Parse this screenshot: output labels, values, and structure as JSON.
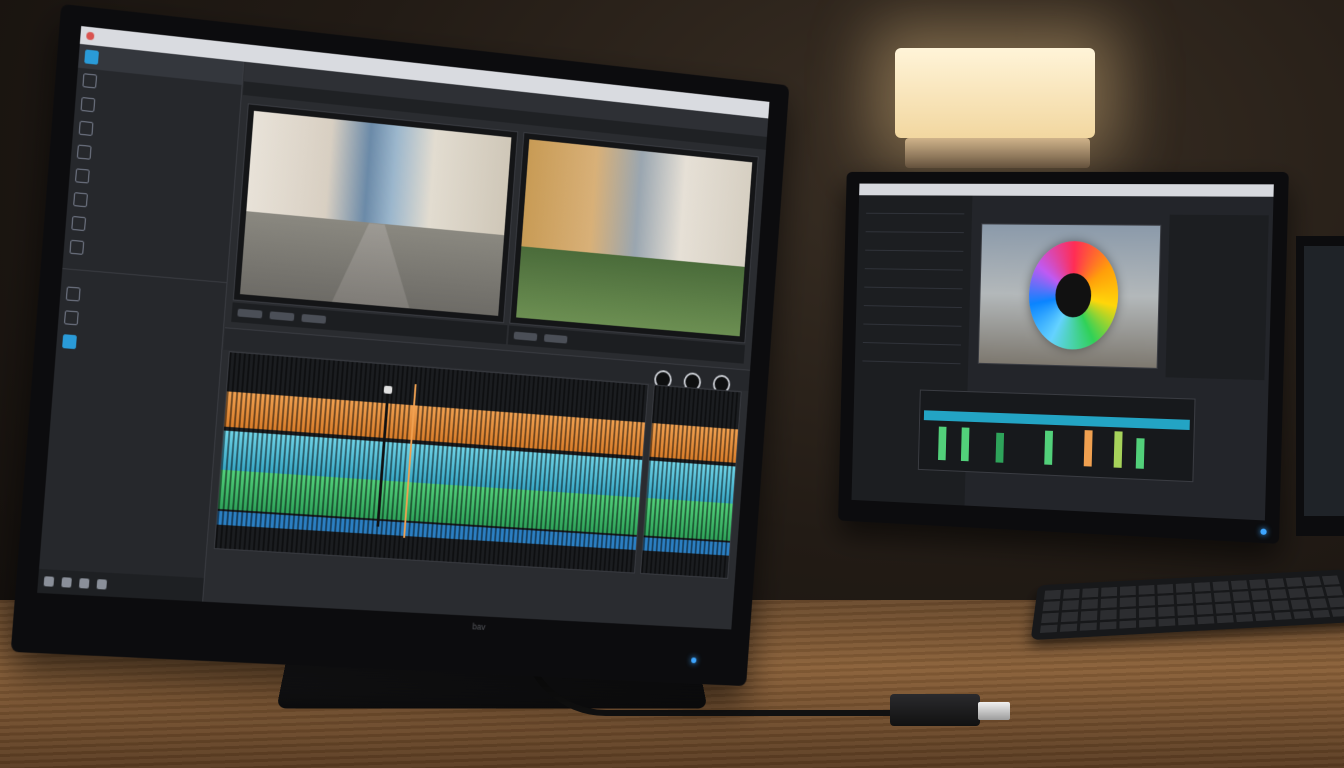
{
  "scene": {
    "description_tags": [
      "video-editing-workstation"
    ]
  },
  "main_monitor": {
    "brand_text": "bav",
    "window_title": "",
    "sidebar": {
      "items": [
        {
          "label": "",
          "icon": "folder-icon"
        },
        {
          "label": "",
          "icon": "media-icon"
        },
        {
          "label": "",
          "icon": "effects-icon"
        },
        {
          "label": "",
          "icon": "audio-icon"
        },
        {
          "label": "",
          "icon": "titles-icon"
        },
        {
          "label": "",
          "icon": "transitions-icon"
        },
        {
          "label": "",
          "icon": "color-icon"
        },
        {
          "label": "",
          "icon": "export-icon"
        },
        {
          "label": "",
          "icon": "settings-icon"
        }
      ],
      "section_header": ""
    },
    "tabs": [],
    "viewers": [
      "street-footage",
      "courtyard-footage"
    ],
    "timeline": {
      "tracks": [
        "orange-audio",
        "cyan-audio",
        "green-audio",
        "blue-video"
      ]
    }
  },
  "secondary_monitor": {
    "panel": "color-grading",
    "wheel": "color-wheel"
  },
  "colors": {
    "accent_blue": "#2a9bd8",
    "track_orange": "#f0a050",
    "track_cyan": "#6fd3e6",
    "track_green": "#52d07a",
    "track_blue": "#2b7fc2",
    "lamp_glow": "#fff4d8"
  }
}
